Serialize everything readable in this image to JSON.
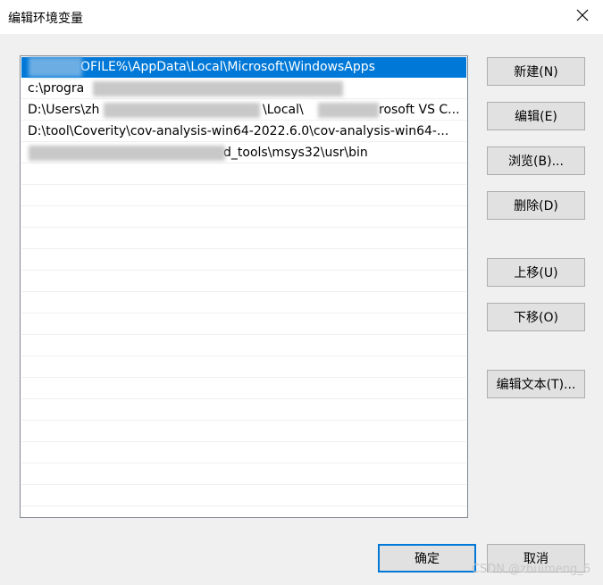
{
  "window": {
    "title": "编辑环境变量",
    "close_icon": "close-icon"
  },
  "list": {
    "items": [
      "%USERPROFILE%\\AppData\\Local\\Microsoft\\WindowsApps",
      "c:\\progra",
      "D:\\Users\\zh",
      "D:\\tool\\Coverity\\cov-analysis-win64-2022.6.0\\cov-analysis-win64-...",
      "d_tools\\msys32\\usr\\bin"
    ],
    "item_labels": {
      "0": "OFILE%\\AppData\\Local\\Microsoft\\WindowsApps",
      "1": "c:\\progra",
      "2a": "D:\\Users\\zh",
      "2b": "\\Local\\",
      "2c": "rosoft VS C...",
      "3": "D:\\tool\\Coverity\\cov-analysis-win64-2022.6.0\\cov-analysis-win64-...",
      "4": "d_tools\\msys32\\usr\\bin"
    },
    "selected_index": 0
  },
  "buttons": {
    "new": "新建(N)",
    "edit": "编辑(E)",
    "browse": "浏览(B)...",
    "delete": "删除(D)",
    "move_up": "上移(U)",
    "move_down": "下移(O)",
    "edit_text": "编辑文本(T)...",
    "ok": "确定",
    "cancel": "取消"
  },
  "watermark": "CSDN @zhuimeng_6",
  "colors": {
    "selection": "#0078d7",
    "button_bg": "#e1e1e1",
    "dialog_bg": "#f0f0f0"
  }
}
